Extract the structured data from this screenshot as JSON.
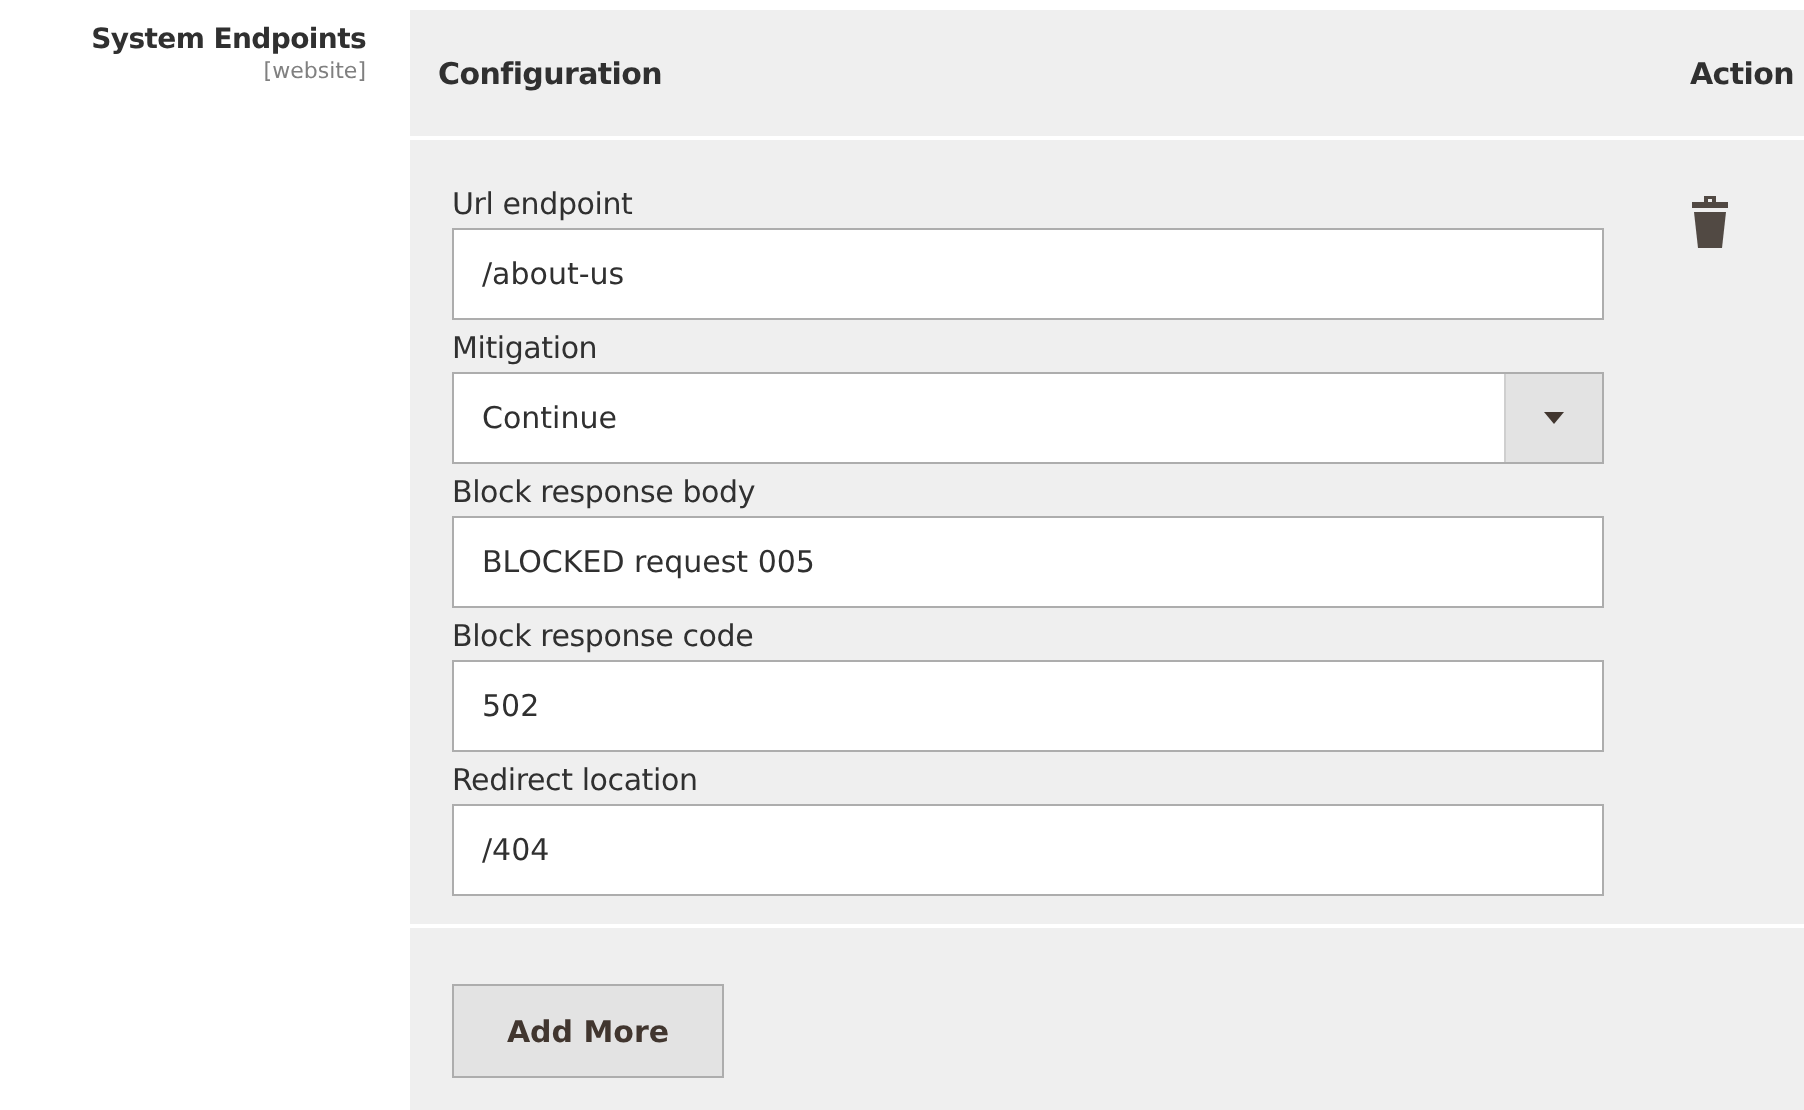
{
  "setting": {
    "label": "System Endpoints",
    "scope": "[website]"
  },
  "table": {
    "columns": [
      "Configuration",
      "Action"
    ],
    "rows": [
      {
        "fields": [
          {
            "kind": "text",
            "label": "Url endpoint",
            "value": "/about-us"
          },
          {
            "kind": "select",
            "label": "Mitigation",
            "value": "Continue"
          },
          {
            "kind": "text",
            "label": "Block response body",
            "value": "BLOCKED request 005"
          },
          {
            "kind": "text",
            "label": "Block response code",
            "value": "502"
          },
          {
            "kind": "text",
            "label": "Redirect location",
            "value": "/404"
          }
        ]
      }
    ]
  },
  "add_button": "Add More"
}
